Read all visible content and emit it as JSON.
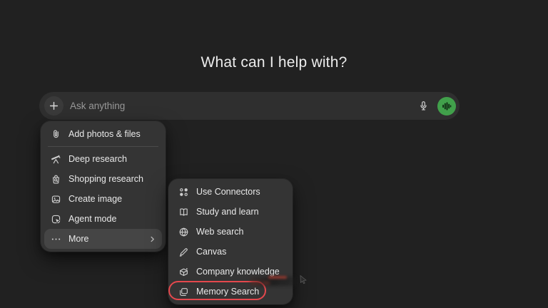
{
  "page": {
    "title": "What can I help with?",
    "background_color": "#212121"
  },
  "composer": {
    "placeholder": "Ask anything",
    "plus_icon": "plus-icon",
    "mic_icon": "microphone-icon",
    "voice_icon": "voice-waveform-icon",
    "voice_button_color": "#41a04b"
  },
  "attach_menu": {
    "items": [
      {
        "label": "Add photos & files",
        "icon": "paperclip-icon"
      },
      {
        "label": "Deep research",
        "icon": "telescope-icon"
      },
      {
        "label": "Shopping research",
        "icon": "shopping-research-icon"
      },
      {
        "label": "Create image",
        "icon": "create-image-icon"
      },
      {
        "label": "Agent mode",
        "icon": "agent-mode-icon"
      },
      {
        "label": "More",
        "icon": "ellipsis-icon",
        "has_submenu": true,
        "state": "hovered"
      }
    ]
  },
  "more_submenu": {
    "items": [
      {
        "label": "Use Connectors",
        "icon": "connectors-icon"
      },
      {
        "label": "Study and learn",
        "icon": "open-book-icon"
      },
      {
        "label": "Web search",
        "icon": "globe-icon"
      },
      {
        "label": "Canvas",
        "icon": "pencil-icon"
      },
      {
        "label": "Company knowledge",
        "icon": "company-knowledge-icon"
      },
      {
        "label": "Memory Search",
        "icon": "memory-cards-icon",
        "annotated": true
      }
    ],
    "annotation_ring_color": "#e5484d"
  }
}
